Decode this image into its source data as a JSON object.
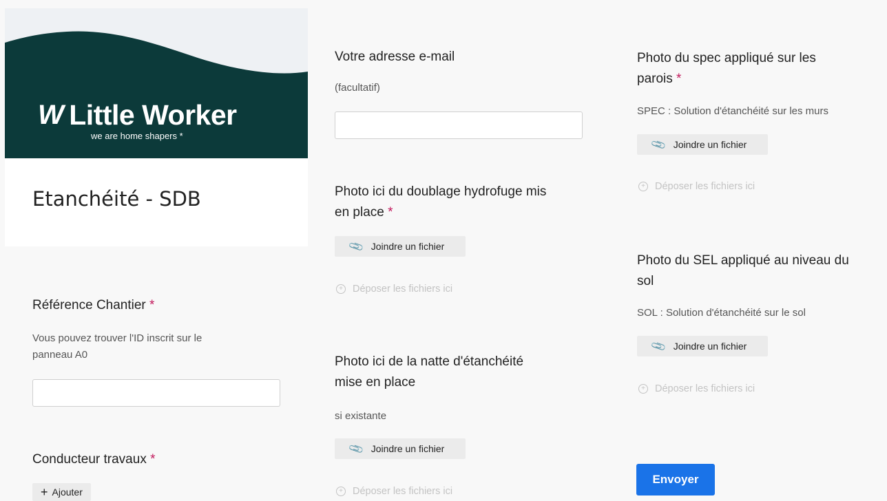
{
  "header": {
    "brand_mark": "W",
    "brand_name": "Little Worker",
    "tagline": "we are home shapers *",
    "form_title": "Etanchéité - SDB"
  },
  "left": {
    "ref_label": "Référence Chantier",
    "ref_help_1": "Vous pouvez trouver l'ID inscrit sur le",
    "ref_help_2": "panneau A0",
    "conducteur_label": "Conducteur travaux",
    "add_label": "Ajouter"
  },
  "middle": {
    "email_label": "Votre adresse e-mail",
    "email_help": "(facultatif)",
    "doublage_label_1": "Photo ici du doublage hydrofuge mis",
    "doublage_label_2": "en place",
    "natte_label_1": "Photo ici de la natte d'étanchéité",
    "natte_label_2": "mise en place",
    "natte_help": "si existante"
  },
  "right": {
    "spec_label_1": "Photo du spec appliqué sur les",
    "spec_label_2": "parois",
    "spec_help": "SPEC : Solution d'étanchéité sur les murs",
    "sel_label_1": "Photo du SEL appliqué au niveau du",
    "sel_label_2": "sol",
    "sel_help": "SOL : Solution d'étanchéité sur le sol"
  },
  "common": {
    "required_mark": "*",
    "attach_label": "Joindre un fichier",
    "drop_label": "Déposer les fichiers ici",
    "submit_label": "Envoyer"
  },
  "colors": {
    "banner": "#0c3a3a",
    "accent": "#1a73e8",
    "required": "#c2185b"
  }
}
